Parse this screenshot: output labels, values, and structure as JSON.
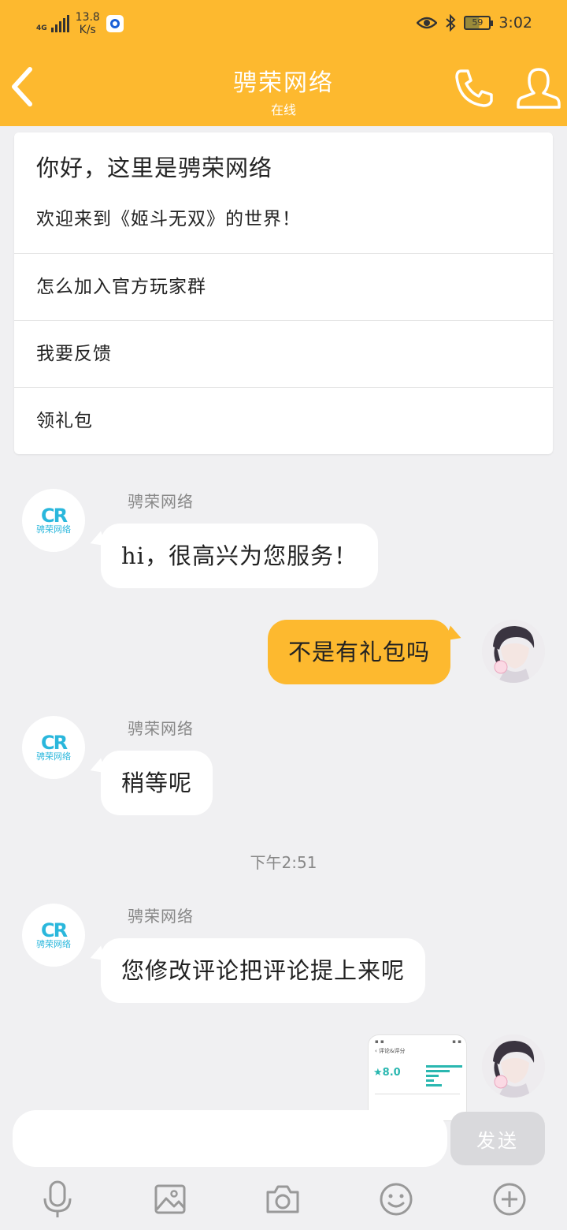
{
  "status_bar": {
    "network": "4G",
    "speed_value": "13.8",
    "speed_unit": "K/s",
    "battery": "59",
    "time": "3:02"
  },
  "header": {
    "title": "骋荣网络",
    "subtitle": "在线"
  },
  "menu": {
    "greeting": "你好，这里是骋荣网络",
    "welcome": "欢迎来到《姬斗无双》的世界！",
    "items": [
      {
        "label": "怎么加入官方玩家群"
      },
      {
        "label": "我要反馈"
      },
      {
        "label": "领礼包"
      }
    ]
  },
  "bot": {
    "logo_text": "CR",
    "logo_sub": "骋荣网络"
  },
  "messages": [
    {
      "sender": "骋荣网络",
      "text": "hi，很高兴为您服务！"
    },
    {
      "text": "不是有礼包吗"
    },
    {
      "sender": "骋荣网络",
      "text": "稍等呢"
    },
    {
      "sender": "骋荣网络",
      "text": "您修改评论把评论提上来呢"
    }
  ],
  "timestamp": "下午2:51",
  "thumbnail": {
    "title": "评论&评分",
    "score": "8.0"
  },
  "composer": {
    "placeholder": "",
    "send_label": "发送"
  },
  "icons": {
    "back": "chevron-left-icon",
    "call": "phone-icon",
    "profile": "person-icon",
    "voice": "microphone-icon",
    "image": "image-icon",
    "camera": "camera-icon",
    "emoji": "emoji-icon",
    "more": "plus-circle-icon"
  },
  "colors": {
    "accent": "#fdb92f",
    "bot_logo": "#2ab7dc",
    "bubble_in": "#ffffff",
    "background": "#f0f0f2"
  }
}
